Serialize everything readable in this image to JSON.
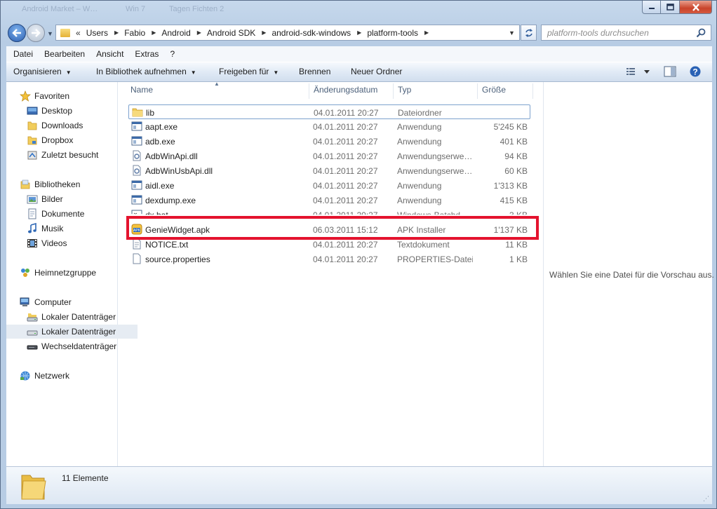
{
  "window": {
    "background_titles": [
      "Android Market – W…",
      "Win 7",
      "Tagen Fichten 2"
    ]
  },
  "address": {
    "overflow": "«",
    "crumbs": [
      "Users",
      "Fabio",
      "Android",
      "Android SDK",
      "android-sdk-windows",
      "platform-tools"
    ]
  },
  "search": {
    "placeholder": "platform-tools durchsuchen"
  },
  "menu": [
    "Datei",
    "Bearbeiten",
    "Ansicht",
    "Extras",
    "?"
  ],
  "toolbar": {
    "organize": "Organisieren",
    "library": "In Bibliothek aufnehmen",
    "share": "Freigeben für",
    "burn": "Brennen",
    "new_folder": "Neuer Ordner"
  },
  "nav": {
    "favorites": "Favoriten",
    "desktop": "Desktop",
    "downloads": "Downloads",
    "dropbox": "Dropbox",
    "recent": "Zuletzt besucht",
    "libraries": "Bibliotheken",
    "pictures": "Bilder",
    "documents": "Dokumente",
    "music": "Musik",
    "videos": "Videos",
    "homegroup": "Heimnetzgruppe",
    "computer": "Computer",
    "disk1": "Lokaler Datenträger",
    "disk2": "Lokaler Datenträger",
    "removable": "Wechseldatenträger",
    "network": "Netzwerk"
  },
  "columns": {
    "name": "Name",
    "date": "Änderungsdatum",
    "type": "Typ",
    "size": "Größe"
  },
  "files": [
    {
      "icon": "folder-icon",
      "name": "lib",
      "date": "04.01.2011 20:27",
      "type": "Dateiordner",
      "size": ""
    },
    {
      "icon": "exe-icon",
      "name": "aapt.exe",
      "date": "04.01.2011 20:27",
      "type": "Anwendung",
      "size": "5'245 KB"
    },
    {
      "icon": "exe-icon",
      "name": "adb.exe",
      "date": "04.01.2011 20:27",
      "type": "Anwendung",
      "size": "401 KB"
    },
    {
      "icon": "dll-icon",
      "name": "AdbWinApi.dll",
      "date": "04.01.2011 20:27",
      "type": "Anwendungserwe…",
      "size": "94 KB"
    },
    {
      "icon": "dll-icon",
      "name": "AdbWinUsbApi.dll",
      "date": "04.01.2011 20:27",
      "type": "Anwendungserwe…",
      "size": "60 KB"
    },
    {
      "icon": "exe-icon",
      "name": "aidl.exe",
      "date": "04.01.2011 20:27",
      "type": "Anwendung",
      "size": "1'313 KB"
    },
    {
      "icon": "exe-icon",
      "name": "dexdump.exe",
      "date": "04.01.2011 20:27",
      "type": "Anwendung",
      "size": "415 KB"
    },
    {
      "icon": "bat-icon",
      "name": "dx.bat",
      "date": "04.01.2011 20:27",
      "type": "Windows-Batchd…",
      "size": "3 KB"
    },
    {
      "icon": "apk-icon",
      "name": "GenieWidget.apk",
      "date": "06.03.2011 15:12",
      "type": "APK Installer",
      "size": "1'137 KB"
    },
    {
      "icon": "text-icon",
      "name": "NOTICE.txt",
      "date": "04.01.2011 20:27",
      "type": "Textdokument",
      "size": "11 KB"
    },
    {
      "icon": "file-icon",
      "name": "source.properties",
      "date": "04.01.2011 20:27",
      "type": "PROPERTIES-Datei",
      "size": "1 KB"
    }
  ],
  "preview": {
    "message": "Wählen Sie eine Datei für die Vorschau aus."
  },
  "details": {
    "count": "11 Elemente"
  },
  "colors": {
    "highlight": "#e4132e",
    "window_frame": "#b7cce4",
    "selection": "#e6ecf3"
  }
}
